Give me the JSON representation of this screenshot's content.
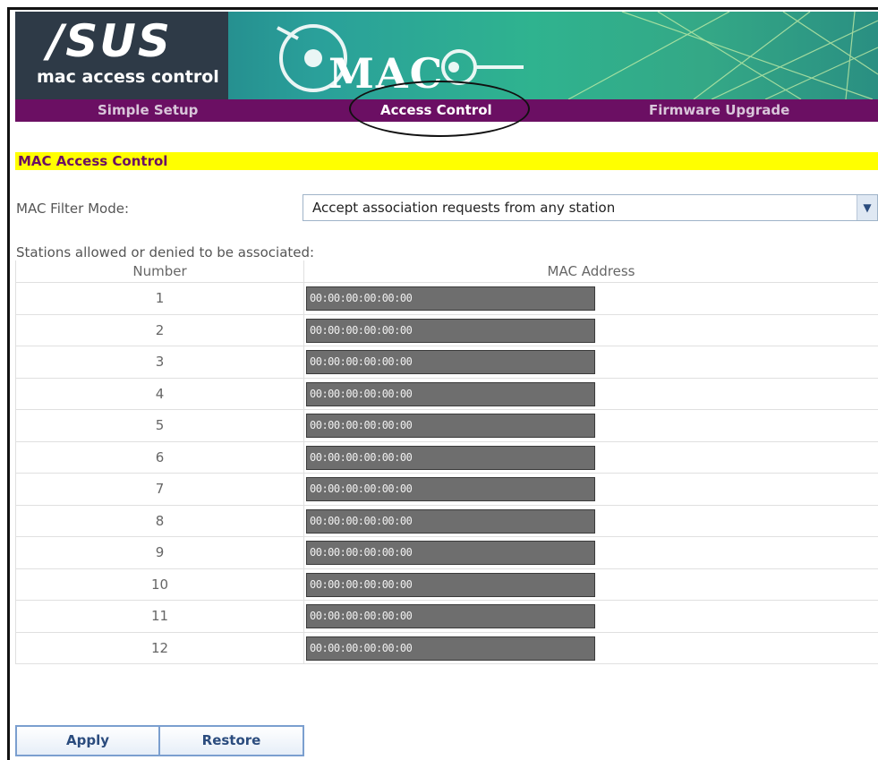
{
  "banner": {
    "brand": "/SUS",
    "subtitle": "mac access control",
    "graphic_text": "MAC"
  },
  "nav": {
    "items": [
      {
        "label": "Simple Setup",
        "active": false
      },
      {
        "label": "Access Control",
        "active": true
      },
      {
        "label": "Firmware Upgrade",
        "active": false
      }
    ]
  },
  "section": {
    "title": "MAC Access Control"
  },
  "filter": {
    "label": "MAC Filter Mode:",
    "selected": "Accept association requests from any station"
  },
  "stations": {
    "label": "Stations allowed or denied to be associated:",
    "headers": {
      "number": "Number",
      "mac": "MAC Address"
    },
    "rows": [
      {
        "num": "1",
        "mac": "00:00:00:00:00:00"
      },
      {
        "num": "2",
        "mac": "00:00:00:00:00:00"
      },
      {
        "num": "3",
        "mac": "00:00:00:00:00:00"
      },
      {
        "num": "4",
        "mac": "00:00:00:00:00:00"
      },
      {
        "num": "5",
        "mac": "00:00:00:00:00:00"
      },
      {
        "num": "6",
        "mac": "00:00:00:00:00:00"
      },
      {
        "num": "7",
        "mac": "00:00:00:00:00:00"
      },
      {
        "num": "8",
        "mac": "00:00:00:00:00:00"
      },
      {
        "num": "9",
        "mac": "00:00:00:00:00:00"
      },
      {
        "num": "10",
        "mac": "00:00:00:00:00:00"
      },
      {
        "num": "11",
        "mac": "00:00:00:00:00:00"
      },
      {
        "num": "12",
        "mac": "00:00:00:00:00:00"
      }
    ]
  },
  "buttons": {
    "apply": "Apply",
    "restore": "Restore"
  },
  "colors": {
    "nav_bg": "#6b0f63",
    "section_bar": "#ffff00",
    "mac_field": "#6e6e6e"
  },
  "icons": {
    "select_arrow": "chevron-down-icon"
  }
}
